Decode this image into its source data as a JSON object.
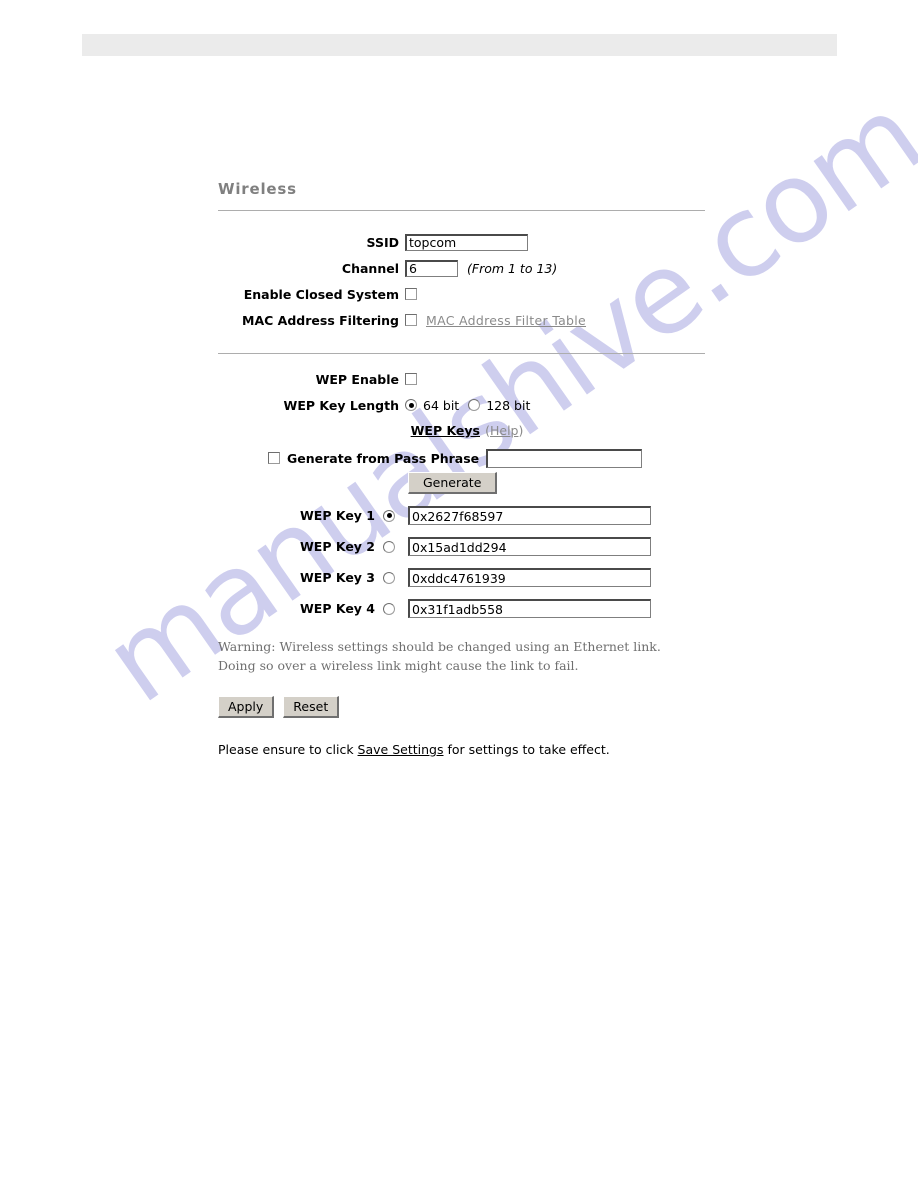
{
  "page": {
    "section_title": "Wireless"
  },
  "watermark": {
    "text": "manualshive.com",
    "color": "#ccccee"
  },
  "topbar": {
    "color": "#ebebeb"
  },
  "basic": {
    "ssid": {
      "label": "SSID",
      "value": "topcom",
      "placeholder": ""
    },
    "channel": {
      "label": "Channel",
      "value": "6",
      "placeholder": "",
      "hint": "(From 1 to 13)"
    },
    "closed_system": {
      "label": "Enable Closed System",
      "checked": false
    },
    "mac_filtering": {
      "label": "MAC Address Filtering",
      "checked": false,
      "link_label": "MAC Address Filter Table"
    }
  },
  "wep": {
    "enable": {
      "label": "WEP Enable",
      "checked": false
    },
    "key_length": {
      "label": "WEP Key Length",
      "options": [
        {
          "label": "64 bit",
          "selected": true
        },
        {
          "label": "128 bit",
          "selected": false
        }
      ]
    },
    "keys_heading": "WEP Keys",
    "help_open": "(",
    "help_label": "Help",
    "help_close": ")",
    "pass_phrase": {
      "label": "Generate from Pass Phrase",
      "checked": false,
      "value": "",
      "placeholder": ""
    },
    "generate_button": "Generate",
    "keys": [
      {
        "label": "WEP Key 1",
        "value": "0x2627f68597",
        "selected": true
      },
      {
        "label": "WEP Key 2",
        "value": "0x15ad1dd294",
        "selected": false
      },
      {
        "label": "WEP Key 3",
        "value": "0xddc4761939",
        "selected": false
      },
      {
        "label": "WEP Key 4",
        "value": "0x31f1adb558",
        "selected": false
      }
    ]
  },
  "warning": {
    "line1": "Warning: Wireless settings should be changed using an Ethernet link.",
    "line2": "Doing so over a wireless link might cause the link to fail."
  },
  "actions": {
    "apply": "Apply",
    "reset": "Reset"
  },
  "footnote": {
    "before": "Please ensure to click ",
    "link": "Save Settings",
    "after": " for settings to take effect."
  }
}
